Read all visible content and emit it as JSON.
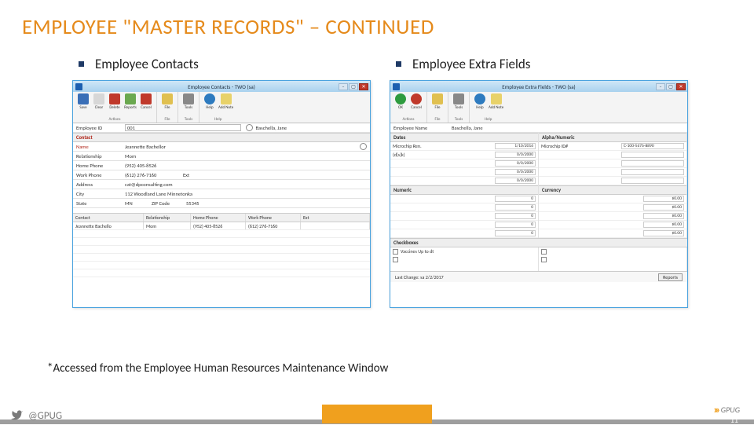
{
  "slide": {
    "title": "EMPLOYEE \"MASTER RECORDS\" – CONTINUED",
    "note": "*Accessed from the Employee Human Resources Maintenance Window",
    "page_number": "11",
    "twitter_handle": "@GPUG",
    "logo_text": "GPUG"
  },
  "left": {
    "heading": "Employee Contacts",
    "window_title": "Employee Contacts - TWO (sa)",
    "ribbon": {
      "actions": {
        "label": "Actions",
        "buttons": [
          "Save",
          "Clear",
          "Delete",
          "Reports",
          "Cancel"
        ]
      },
      "file": {
        "label": "File",
        "buttons": [
          "File"
        ]
      },
      "tools": {
        "label": "Tools",
        "buttons": [
          "Tools"
        ]
      },
      "help": {
        "label": "Help",
        "buttons": [
          "Help",
          "Add Note"
        ]
      }
    },
    "employee_id_label": "Employee ID",
    "employee_id": "001",
    "employee_name": "Baschella, Jane",
    "contact_section": "Contact",
    "fields": {
      "name_label": "Name",
      "name": "Jeannette Bachellor",
      "relationship_label": "Relationship",
      "relationship": "Mom",
      "home_phone_label": "Home Phone",
      "home_phone": "(952) 405-8526",
      "work_phone_label": "Work Phone",
      "work_phone": "(612) 276-7160",
      "ext_label": "Ext",
      "address_label": "Address",
      "address": "cat@dpconsulting.com",
      "city_label": "City",
      "city": "112 Woodland Lane  Minnetonka",
      "state_label": "State",
      "state": "MN",
      "zip_label": "ZIP Code",
      "zip": "55345"
    },
    "grid": {
      "headers": [
        "Contact",
        "Relationship",
        "Home Phone",
        "Work Phone",
        "Ext"
      ],
      "row": [
        "Jeannette Bachello",
        "Mom",
        "(952) 405-8526",
        "(612) 276-7160",
        ""
      ]
    }
  },
  "right": {
    "heading": "Employee Extra Fields",
    "window_title": "Employee Extra Fields - TWO (sa)",
    "ribbon": {
      "actions": {
        "label": "Actions",
        "buttons": [
          "OK",
          "Cancel"
        ]
      },
      "file": {
        "label": "File",
        "buttons": [
          "File"
        ]
      },
      "tools": {
        "label": "Tools",
        "buttons": [
          "Tools"
        ]
      },
      "help": {
        "label": "Help",
        "buttons": [
          "Help",
          "Add Note"
        ]
      }
    },
    "employee_name_label": "Employee Name",
    "employee_name": "Baschella, Jane",
    "dates_label": "Dates",
    "alpha_label": "Alpha/Numeric",
    "dates": {
      "microchip_label": "Microchip Ren.",
      "microchip": "1/10/2016",
      "default_date": "0/0/2000"
    },
    "alpha": {
      "microchip_id_label": "Microchip ID#",
      "microchip_id": "C-100-5676-8890"
    },
    "numeric_label": "Numeric",
    "currency_label": "Currency",
    "numeric_vals": [
      "0",
      "0",
      "0",
      "0",
      "0"
    ],
    "currency_vals": [
      "$0.00",
      "$0.00",
      "$0.00",
      "$0.00",
      "$0.00"
    ],
    "checkboxes_label": "Checkboxes",
    "checkbox1": "Vaccines Up to dt",
    "last_change_label": "Last Change:",
    "last_change_by": "sa",
    "last_change_date": "2/2/2017",
    "reports_btn": "Reports"
  }
}
